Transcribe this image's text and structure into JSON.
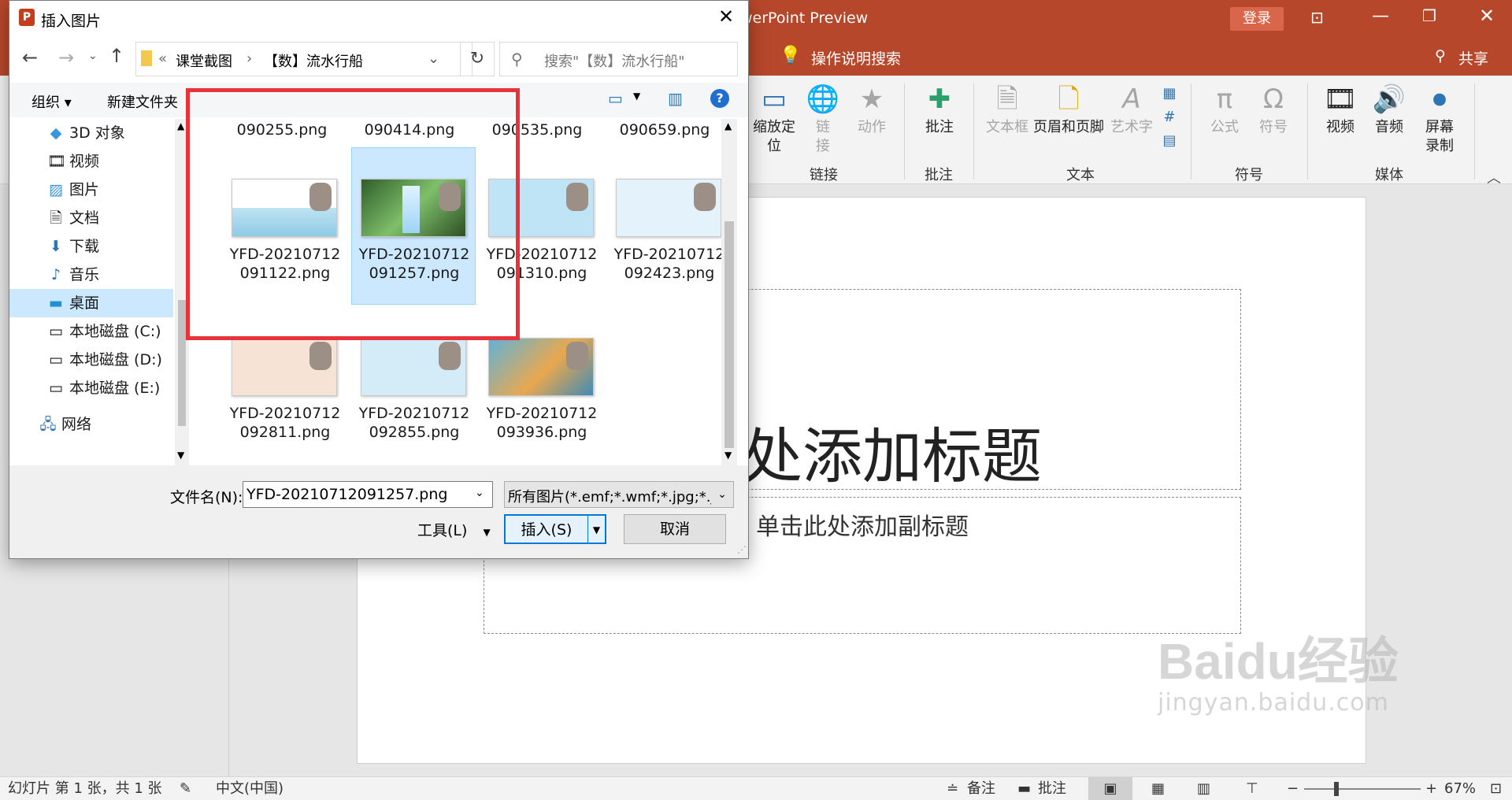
{
  "ppt": {
    "title_partial": "werPoint Preview",
    "login": "登录",
    "tell_me": "操作说明搜索",
    "share": "共享",
    "ribbon": {
      "buttons": [
        {
          "label": "缩放定\n位",
          "disabled": false
        },
        {
          "label": "链\n接",
          "disabled": true
        },
        {
          "label": "动作",
          "disabled": true
        },
        {
          "label": "批注",
          "disabled": false
        },
        {
          "label": "文本框",
          "disabled": true
        },
        {
          "label": "页眉和页脚",
          "disabled": false
        },
        {
          "label": "艺术字",
          "disabled": true
        },
        {
          "label": "公式",
          "disabled": true
        },
        {
          "label": "符号",
          "disabled": true
        },
        {
          "label": "视频",
          "disabled": false
        },
        {
          "label": "音频",
          "disabled": false
        },
        {
          "label": "屏幕\n录制",
          "disabled": false
        }
      ],
      "groups": [
        "链接",
        "批注",
        "文本",
        "符号",
        "媒体"
      ]
    },
    "slide": {
      "title_placeholder": "此处添加标题",
      "subtitle_placeholder": "单击此处添加副标题"
    },
    "status": {
      "slide_info": "幻灯片 第 1 张，共 1 张",
      "language": "中文(中国)",
      "notes": "备注",
      "comments": "批注",
      "zoom": "67%"
    }
  },
  "dialog": {
    "title": "插入图片",
    "breadcrumb": [
      "课堂截图",
      "【数】流水行船"
    ],
    "search_placeholder": "搜索\"【数】流水行船\"",
    "organize": "组织",
    "new_folder": "新建文件夹",
    "nav_items": [
      {
        "label": "3D 对象",
        "icon": "cube-icon"
      },
      {
        "label": "视频",
        "icon": "video-icon"
      },
      {
        "label": "图片",
        "icon": "picture-icon"
      },
      {
        "label": "文档",
        "icon": "document-icon"
      },
      {
        "label": "下载",
        "icon": "download-icon"
      },
      {
        "label": "音乐",
        "icon": "music-icon"
      },
      {
        "label": "桌面",
        "icon": "desktop-icon",
        "selected": true
      },
      {
        "label": "本地磁盘 (C:)",
        "icon": "drive-icon"
      },
      {
        "label": "本地磁盘 (D:)",
        "icon": "drive-icon"
      },
      {
        "label": "本地磁盘 (E:)",
        "icon": "drive-icon"
      },
      {
        "label": "网络",
        "icon": "network-icon"
      }
    ],
    "files_top_row": [
      "090255.png",
      "090414.png",
      "090535.png",
      "090659.png"
    ],
    "files": [
      {
        "line1": "YFD-20210712",
        "line2": "091122.png",
        "theme": "ocean"
      },
      {
        "line1": "YFD-20210712",
        "line2": "091257.png",
        "theme": "waterfall",
        "selected": true
      },
      {
        "line1": "YFD-20210712",
        "line2": "091310.png",
        "theme": "blue"
      },
      {
        "line1": "YFD-20210712",
        "line2": "092423.png",
        "theme": "light"
      },
      {
        "line1": "YFD-20210712",
        "line2": "092811.png",
        "theme": "pink"
      },
      {
        "line1": "YFD-20210712",
        "line2": "092855.png",
        "theme": "card"
      },
      {
        "line1": "YFD-20210712",
        "line2": "093936.png",
        "theme": "river"
      }
    ],
    "filename_label": "文件名(N):",
    "filename_value": "YFD-20210712091257.png",
    "filter_value": "所有图片(*.emf;*.wmf;*.jpg;*.jp",
    "tools": "工具(L)",
    "insert": "插入(S)",
    "cancel": "取消"
  },
  "watermark": {
    "brand": "Baidu经验",
    "url": "jingyan.baidu.com"
  }
}
